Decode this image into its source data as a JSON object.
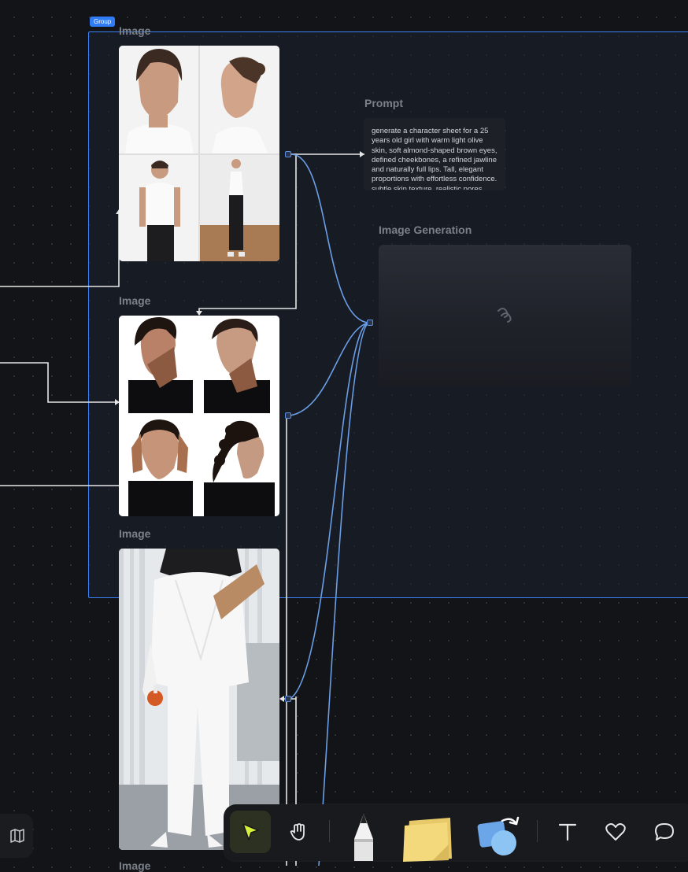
{
  "group": {
    "badge": "Group"
  },
  "nodes": {
    "image1": {
      "title": "Image"
    },
    "image2": {
      "title": "Image"
    },
    "image3": {
      "title": "Image"
    },
    "image4": {
      "title": "Image"
    },
    "prompt": {
      "title": "Prompt",
      "text": "generate a character sheet for a 25 years old girl with warm light olive skin, soft almond-shaped brown eyes, defined cheekbones, a refined jawline and naturally full lips. Tall, elegant proportions with effortless confidence. subtle skin texture, realistic pores"
    },
    "generation": {
      "title": "Image Generation"
    }
  },
  "toolbar": {
    "tools": [
      {
        "icon": "select-cursor-icon",
        "active": true
      },
      {
        "icon": "hand-pan-icon",
        "active": false
      },
      {
        "icon": "pen-marker-icon",
        "active": false
      },
      {
        "icon": "sticky-note-icon",
        "active": false
      },
      {
        "icon": "shapes-icon",
        "active": false
      },
      {
        "icon": "text-icon",
        "active": false
      },
      {
        "icon": "heart-icon",
        "active": false
      },
      {
        "icon": "comment-icon",
        "active": false
      }
    ]
  },
  "minimap": {
    "icon": "map-icon"
  },
  "colors": {
    "canvas": "#121417",
    "group_border": "#3b82f6",
    "wire_blue": "#6b9ee6",
    "wire_white": "#e6e6e6",
    "active_tool": "#d6f03c"
  }
}
